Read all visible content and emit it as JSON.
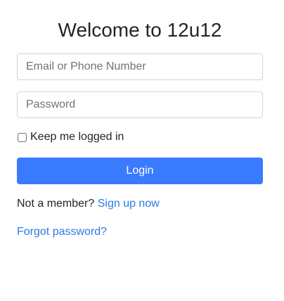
{
  "page": {
    "title": "Welcome to 12u12"
  },
  "form": {
    "email_placeholder": "Email or Phone Number",
    "email_value": "",
    "password_placeholder": "Password",
    "password_value": "",
    "remember_label": "Keep me logged in",
    "remember_checked": false,
    "login_label": "Login"
  },
  "footer": {
    "member_text": "Not a member?",
    "signup_link": "Sign up now",
    "forgot_link": "Forgot password?"
  },
  "colors": {
    "primary_button": "#3a7afe",
    "link": "#2a7ae2",
    "border": "#ced4da"
  }
}
